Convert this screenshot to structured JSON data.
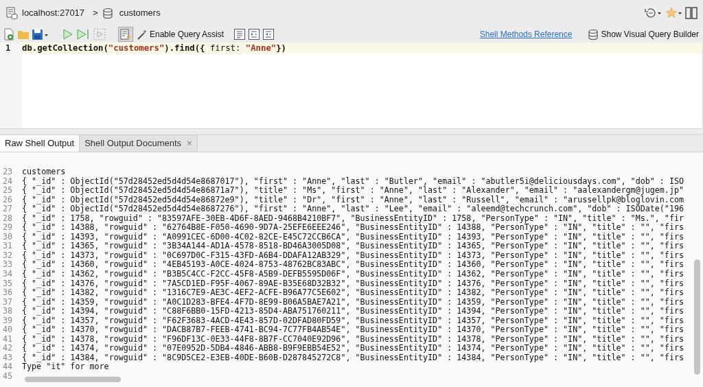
{
  "breadcrumb": {
    "server": "localhost:27017",
    "separator": ">",
    "collection": "customers"
  },
  "toolbar": {
    "query_assist": "Enable Query Assist",
    "reference_link": "Shell Methods Reference",
    "builder": "Show Visual Query Builder"
  },
  "editor": {
    "lines": [
      {
        "number": "1",
        "current": true,
        "tokens": [
          {
            "kind": "code",
            "text": "db.getCollection("
          },
          {
            "kind": "string",
            "text": "\"customers\""
          },
          {
            "kind": "code",
            "text": ").find({ "
          },
          {
            "kind": "plain",
            "text": "first: "
          },
          {
            "kind": "string",
            "text": "\"Anne\""
          },
          {
            "kind": "code",
            "text": "})"
          }
        ]
      }
    ]
  },
  "tabs": [
    {
      "label": "Raw Shell Output",
      "selected": true
    },
    {
      "label": "Shell Output Documents",
      "selected": false,
      "close": "×"
    }
  ],
  "output": {
    "lines": [
      {
        "number": "23",
        "text": "customers"
      },
      {
        "number": "24",
        "text": "{ \"_id\" : ObjectId(\"57d28452ed5d4d54e8687017\"), \"first\" : \"Anne\", \"last\" : \"Butler\", \"email\" : \"abutler5i@deliciousdays.com\", \"dob\" : ISO"
      },
      {
        "number": "25",
        "text": "{ \"_id\" : ObjectId(\"57d28452ed5d4d54e86871a7\"), \"title\" : \"Ms\", \"first\" : \"Anne\", \"last\" : \"Alexander\", \"email\" : \"aalexandergm@jugem.jp\""
      },
      {
        "number": "26",
        "text": "{ \"_id\" : ObjectId(\"57d28452ed5d4d54e86872e9\"), \"title\" : \"Dr\", \"first\" : \"Anne\", \"last\" : \"Russell\", \"email\" : \"arussellpk@bloglovin.com"
      },
      {
        "number": "27",
        "text": "{ \"_id\" : ObjectId(\"57d28452ed5d4d54e8687276\"), \"first\" : \"Anne\", \"last\" : \"Lee\", \"email\" : \"aleemd@techcrunch.com\", \"dob\" : ISODate(\"196"
      },
      {
        "number": "28",
        "text": "{ \"_id\" : 1758, \"rowguid\" : \"83597AFE-30EB-4D6F-8AED-9468B4210BF7\", \"BusinessEntityID\" : 1758, \"PersonType\" : \"IN\", \"title\" : \"Ms.\", \"fir"
      },
      {
        "number": "29",
        "text": "{ \"_id\" : 14388, \"rowguid\" : \"62764B8E-F050-4690-9D7A-25EFE6EEE246\", \"BusinessEntityID\" : 14388, \"PersonType\" : \"IN\", \"title\" : \"\", \"firs"
      },
      {
        "number": "30",
        "text": "{ \"_id\" : 14393, \"rowguid\" : \"A0991CEC-6D00-4C02-82CE-E45C72CCB6CA\", \"BusinessEntityID\" : 14393, \"PersonType\" : \"IN\", \"title\" : \"\", \"firs"
      },
      {
        "number": "31",
        "text": "{ \"_id\" : 14365, \"rowguid\" : \"3B34A144-AD1A-4578-8518-BD46A3005D08\", \"BusinessEntityID\" : 14365, \"PersonType\" : \"IN\", \"title\" : \"\", \"firs"
      },
      {
        "number": "32",
        "text": "{ \"_id\" : 14373, \"rowguid\" : \"0C697D0C-F315-43FD-A6B4-DDAFA12AB329\", \"BusinessEntityID\" : 14373, \"PersonType\" : \"IN\", \"title\" : \"\", \"firs"
      },
      {
        "number": "33",
        "text": "{ \"_id\" : 14360, \"rowguid\" : \"4EB45193-A0CE-4024-8753-48762BC83ABC\", \"BusinessEntityID\" : 14360, \"PersonType\" : \"IN\", \"title\" : \"\", \"firs"
      },
      {
        "number": "34",
        "text": "{ \"_id\" : 14362, \"rowguid\" : \"B3B5C4CC-F2CC-45F8-A5B9-DEFB5595D06F\", \"BusinessEntityID\" : 14362, \"PersonType\" : \"IN\", \"title\" : \"\", \"firs"
      },
      {
        "number": "35",
        "text": "{ \"_id\" : 14376, \"rowguid\" : \"7A5CD1ED-F95F-4067-89AE-B35E68D32B32\", \"BusinessEntityID\" : 14376, \"PersonType\" : \"IN\", \"title\" : \"\", \"firs"
      },
      {
        "number": "36",
        "text": "{ \"_id\" : 14382, \"rowguid\" : \"1316C7E9-AE3C-4EF2-ACFE-B96A77C5E602\", \"BusinessEntityID\" : 14382, \"PersonType\" : \"IN\", \"title\" : \"\", \"firs"
      },
      {
        "number": "37",
        "text": "{ \"_id\" : 14359, \"rowguid\" : \"A0C1D283-BFE4-4F7D-8E99-B06A5BAE7A21\", \"BusinessEntityID\" : 14359, \"PersonType\" : \"IN\", \"title\" : \"\", \"firs"
      },
      {
        "number": "38",
        "text": "{ \"_id\" : 14394, \"rowguid\" : \"C88F6BB0-15FD-4213-85D4-ABA751760211\", \"BusinessEntityID\" : 14394, \"PersonType\" : \"IN\", \"title\" : \"\", \"firs"
      },
      {
        "number": "39",
        "text": "{ \"_id\" : 14357, \"rowguid\" : \"F62F3683-4ACD-4E43-857D-02DFAD80FD59\", \"BusinessEntityID\" : 14357, \"PersonType\" : \"IN\", \"title\" : \"\", \"firs"
      },
      {
        "number": "40",
        "text": "{ \"_id\" : 14370, \"rowguid\" : \"DACB87B7-FEEB-4741-BC94-7C77FB4AB54E\", \"BusinessEntityID\" : 14370, \"PersonType\" : \"IN\", \"title\" : \"\", \"firs"
      },
      {
        "number": "41",
        "text": "{ \"_id\" : 14378, \"rowguid\" : \"F96DF13C-0E33-44F8-8B7F-CC7040E92D96\", \"BusinessEntityID\" : 14378, \"PersonType\" : \"IN\", \"title\" : \"\", \"firs"
      },
      {
        "number": "42",
        "text": "{ \"_id\" : 14374, \"rowguid\" : \"07E0952D-5DB4-4846-ABB8-B9F9EBB54E52\", \"BusinessEntityID\" : 14374, \"PersonType\" : \"IN\", \"title\" : \"\", \"firs"
      },
      {
        "number": "43",
        "text": "{ \"_id\" : 14384, \"rowguid\" : \"8C9D5CE2-E3EB-40DE-B60B-D287845272C8\", \"BusinessEntityID\" : 14384, \"PersonType\" : \"IN\", \"title\" : \"\", \"firs"
      },
      {
        "number": "44",
        "text": "Type \"it\" for more"
      },
      {
        "number": "45"
      }
    ]
  }
}
